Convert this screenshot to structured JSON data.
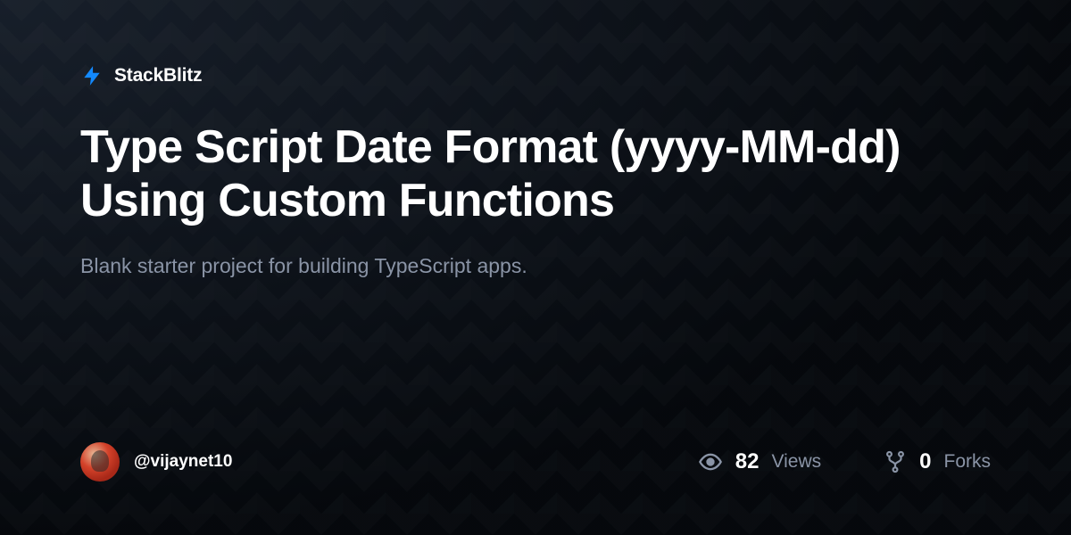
{
  "brand": {
    "name": "StackBlitz"
  },
  "project": {
    "title": "Type Script Date Format (yyyy-MM-dd) Using Custom Functions",
    "description": "Blank starter project for building TypeScript apps."
  },
  "author": {
    "username": "@vijaynet10"
  },
  "stats": {
    "views": {
      "value": "82",
      "label": "Views"
    },
    "forks": {
      "value": "0",
      "label": "Forks"
    }
  },
  "colors": {
    "accent": "#1389fd",
    "muted": "#8a94a6"
  }
}
